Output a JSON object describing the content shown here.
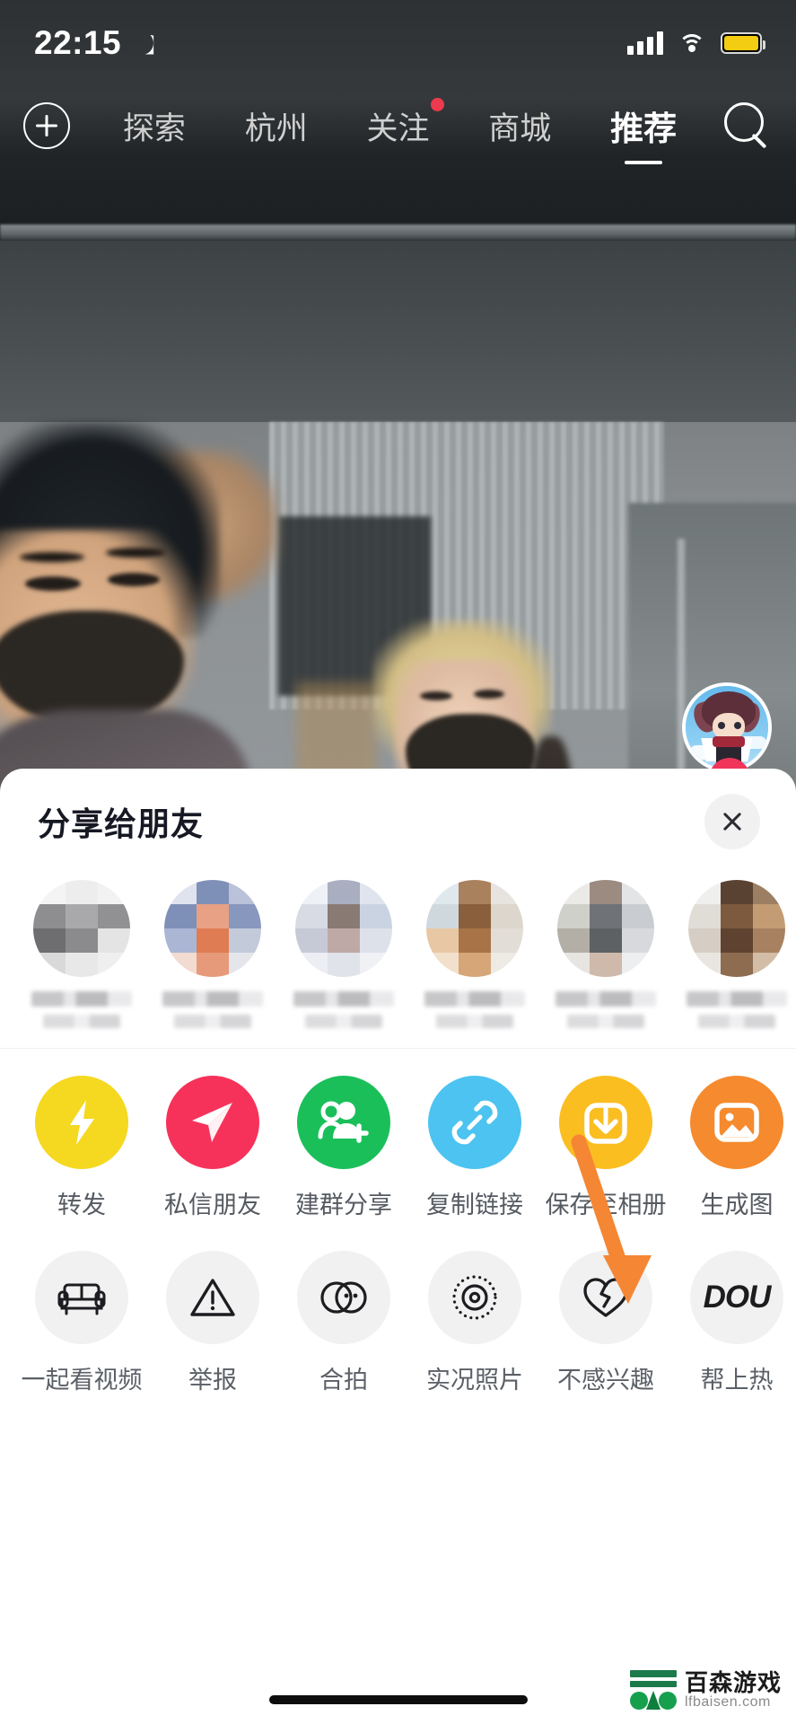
{
  "status_bar": {
    "time": "22:15",
    "moon_icon": "crescent-moon-icon",
    "signal_icon": "cellular-signal-icon",
    "wifi_icon": "wifi-icon",
    "battery_icon": "battery-icon"
  },
  "top_nav": {
    "add_label": "+",
    "add_icon": "plus-circle-icon",
    "search_icon": "search-icon",
    "tabs": [
      {
        "label": "探索",
        "active": false,
        "badge": false
      },
      {
        "label": "杭州",
        "active": false,
        "badge": false
      },
      {
        "label": "关注",
        "active": false,
        "badge": true
      },
      {
        "label": "商城",
        "active": false,
        "badge": false
      },
      {
        "label": "推荐",
        "active": true,
        "badge": false
      }
    ]
  },
  "right_rail": {
    "avatar_icon": "user-avatar",
    "follow_icon": "follow-plus-icon",
    "like_icon": "heart-icon"
  },
  "share_sheet": {
    "title": "分享给朋友",
    "close_icon": "close-icon",
    "friends": [
      {
        "name_blurred": true
      },
      {
        "name_blurred": true
      },
      {
        "name_blurred": true
      },
      {
        "name_blurred": true
      },
      {
        "name_blurred": true
      },
      {
        "name_blurred": true
      }
    ],
    "action_rows": [
      [
        {
          "label": "转发",
          "icon": "repost-lightning-icon",
          "color": "#F5D820",
          "style": "filled"
        },
        {
          "label": "私信朋友",
          "icon": "paper-plane-icon",
          "color": "#F6325B",
          "style": "filled"
        },
        {
          "label": "建群分享",
          "icon": "group-add-icon",
          "color": "#1BBF5A",
          "style": "filled"
        },
        {
          "label": "复制链接",
          "icon": "link-icon",
          "color": "#4CC3F0",
          "style": "filled"
        },
        {
          "label": "保存至相册",
          "icon": "download-icon",
          "color": "#FBBE21",
          "style": "filled"
        },
        {
          "label": "生成图",
          "icon": "image-icon",
          "color": "#F58A2E",
          "style": "filled"
        }
      ],
      [
        {
          "label": "一起看视频",
          "icon": "sofa-icon",
          "color": "#F1F1F2",
          "style": "outline"
        },
        {
          "label": "举报",
          "icon": "warning-icon",
          "color": "#F1F1F2",
          "style": "outline"
        },
        {
          "label": "合拍",
          "icon": "duet-circles-icon",
          "color": "#F1F1F2",
          "style": "outline"
        },
        {
          "label": "实况照片",
          "icon": "live-photo-icon",
          "color": "#F1F1F2",
          "style": "outline"
        },
        {
          "label": "不感兴趣",
          "icon": "broken-heart-icon",
          "color": "#F1F1F2",
          "style": "outline"
        },
        {
          "label": "帮上热",
          "icon": "dou-plus-icon",
          "color": "#F1F1F2",
          "style": "outline",
          "text_icon": "DOU"
        }
      ]
    ]
  },
  "annotation": {
    "arrow_color": "#F58634",
    "points_to": "保存至相册"
  },
  "watermark": {
    "cn": "百森游戏",
    "en": "lfbaisen.com"
  }
}
